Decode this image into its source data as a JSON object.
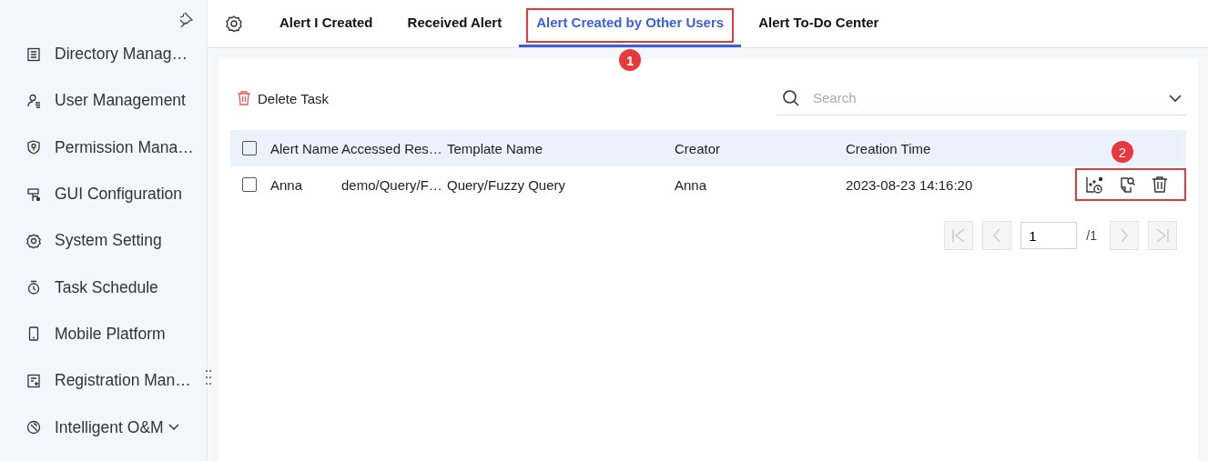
{
  "sidebar": {
    "items": [
      {
        "label": "Directory Manag…",
        "expandable": false
      },
      {
        "label": "User Management",
        "expandable": false
      },
      {
        "label": "Permission Mana…",
        "expandable": false
      },
      {
        "label": "GUI Configuration",
        "expandable": false
      },
      {
        "label": "System Setting",
        "expandable": false
      },
      {
        "label": "Task Schedule",
        "expandable": false
      },
      {
        "label": "Mobile Platform",
        "expandable": false
      },
      {
        "label": "Registration Man…",
        "expandable": false
      },
      {
        "label": "Intelligent O&M",
        "expandable": true
      }
    ]
  },
  "tabs": [
    {
      "label": "Alert I Created",
      "selected": false
    },
    {
      "label": "Received Alert",
      "selected": false
    },
    {
      "label": "Alert Created by Other Users",
      "selected": true,
      "annotation": "1"
    },
    {
      "label": "Alert To-Do Center",
      "selected": false
    }
  ],
  "toolbar": {
    "delete_button": "Delete Task",
    "search": {
      "placeholder": "Search"
    }
  },
  "table": {
    "columns": [
      "Alert Name",
      "Accessed Res…",
      "Template Name",
      "Creator",
      "Creation Time"
    ],
    "all_checked": false,
    "actions_annotation": "2",
    "rows": [
      {
        "checked": false,
        "cells": [
          "Anna",
          "demo/Query/F…",
          "Query/Fuzzy Query",
          "Anna",
          "2023-08-23 14:16:20"
        ]
      }
    ]
  },
  "pagination": {
    "page": "1",
    "total": "/1"
  }
}
